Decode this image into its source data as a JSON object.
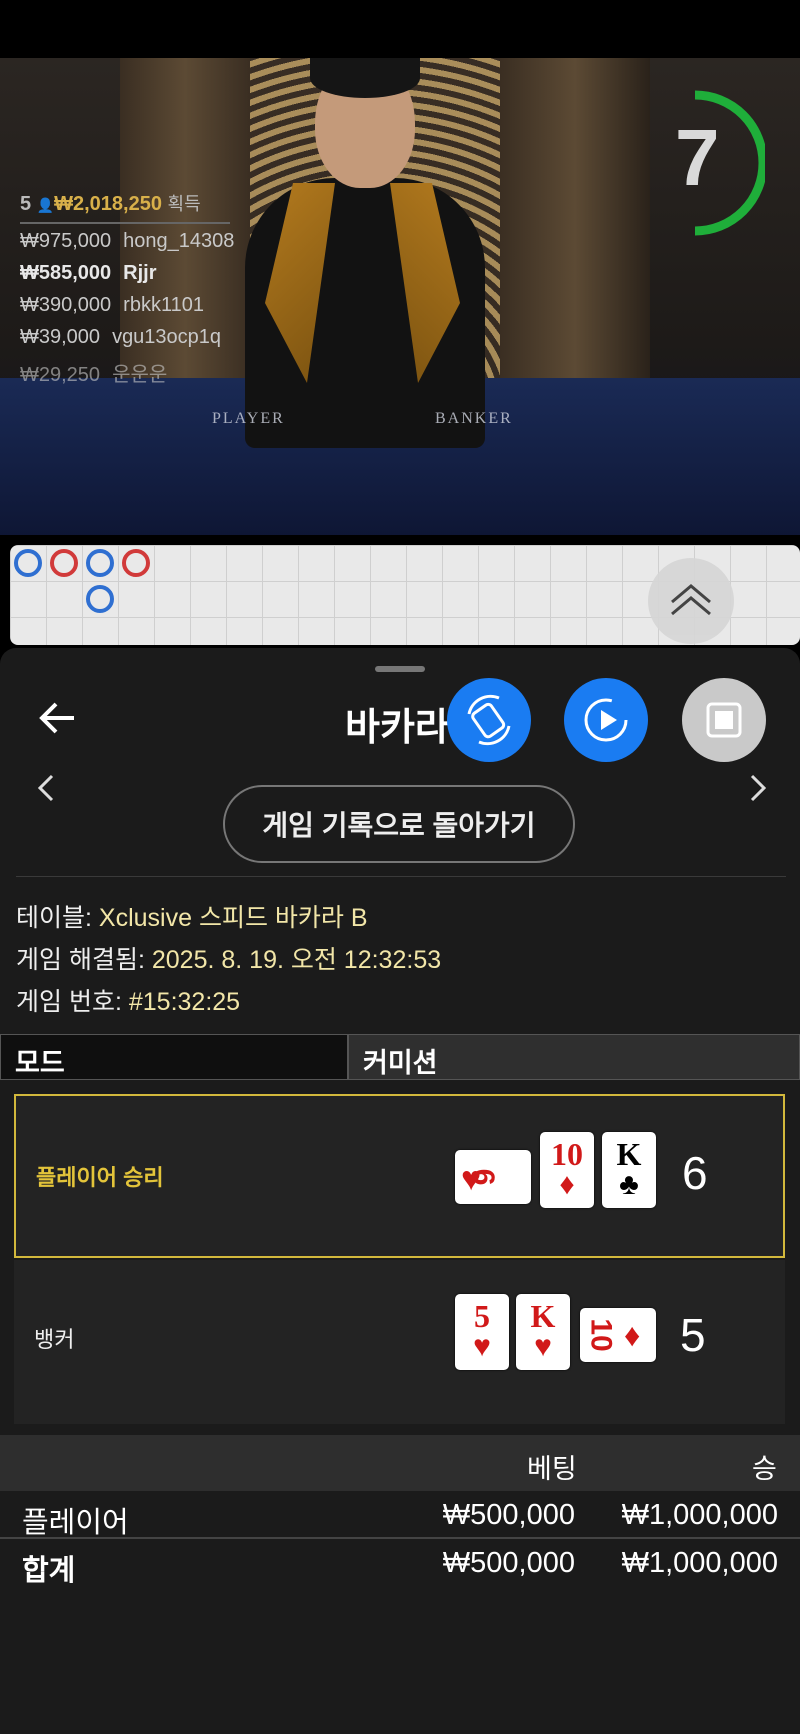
{
  "video": {
    "player_count": "5",
    "total_won": "₩2,018,250",
    "won_word": "획득",
    "winners": [
      {
        "amount": "₩975,000",
        "name": "hong_14308"
      },
      {
        "amount": "₩585,000",
        "name": "Rjjr"
      },
      {
        "amount": "₩390,000",
        "name": "rbkk1101"
      },
      {
        "amount": "₩39,000",
        "name": "vgu13ocp1q"
      },
      {
        "amount": "₩29,250",
        "name": "운운운"
      }
    ],
    "timer": "7",
    "table_label_player": "PLAYER",
    "table_label_banker": "BANKER"
  },
  "sheet": {
    "title": "바카라",
    "history_button": "게임 기록으로 돌아가기",
    "table_label": "테이블:",
    "table_value": "Xclusive 스피드 바카라 B",
    "resolved_label": "게임 해결됨:",
    "resolved_value": "2025. 8. 19. 오전 12:32:53",
    "game_no_label": "게임 번호:",
    "game_no_value": "#15:32:25"
  },
  "tabs": {
    "mode": "모드",
    "commission": "커미션"
  },
  "outcomes": {
    "player": {
      "label": "플레이어 승리",
      "total": "6",
      "cards": [
        {
          "rank": "9",
          "suit": "♥"
        },
        {
          "rank": "10",
          "suit": "♦"
        },
        {
          "rank": "K",
          "suit": "♣"
        }
      ]
    },
    "banker": {
      "label": "뱅커",
      "total": "5",
      "cards": [
        {
          "rank": "5",
          "suit": "♥"
        },
        {
          "rank": "K",
          "suit": "♥"
        },
        {
          "rank": "10",
          "suit": "♦"
        }
      ]
    }
  },
  "bets": {
    "header_bet": "베팅",
    "header_win": "승",
    "rows": [
      {
        "name": "플레이어",
        "bet": "₩500,000",
        "win": "₩1,000,000"
      },
      {
        "name": "합계",
        "bet": "₩500,000",
        "win": "₩1,000,000"
      }
    ]
  },
  "colors": {
    "accent_blue": "#1a7cf2",
    "gold": "#d2b83c",
    "timer_green": "#1fae3a"
  }
}
